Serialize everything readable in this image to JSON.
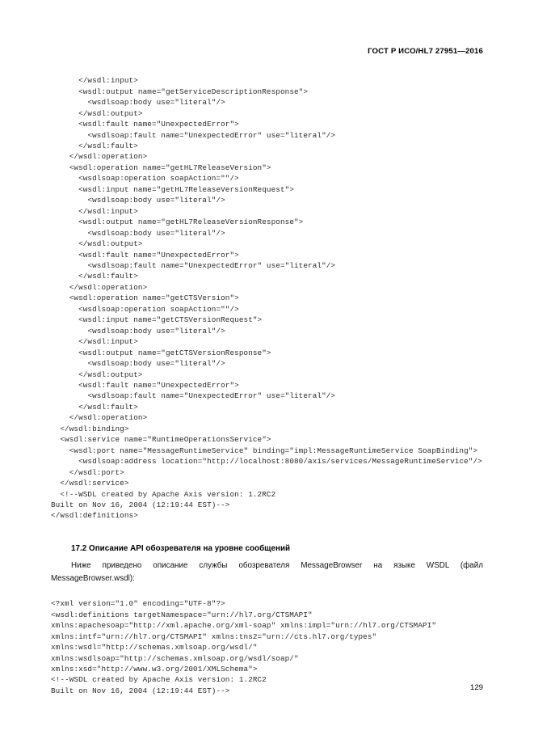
{
  "document": {
    "running_header": "ГОСТ Р ИСО/HL7 27951—2016",
    "page_number": "129"
  },
  "code_block_1": {
    "name": "wsdl-binding-service-listing",
    "lines": [
      "      </wsdl:input>",
      "      <wsdl:output name=\"getServiceDescriptionResponse\">",
      "        <wsdlsoap:body use=\"literal\"/>",
      "      </wsdl:output>",
      "      <wsdl:fault name=\"UnexpectedError\">",
      "        <wsdlsoap:fault name=\"UnexpectedError\" use=\"literal\"/>",
      "      </wsdl:fault>",
      "    </wsdl:operation>",
      "    <wsdl:operation name=\"getHL7ReleaseVersion\">",
      "      <wsdlsoap:operation soapAction=\"\"/>",
      "      <wsdl:input name=\"getHL7ReleaseVersionRequest\">",
      "        <wsdlsoap:body use=\"literal\"/>",
      "      </wsdl:input>",
      "      <wsdl:output name=\"getHL7ReleaseVersionResponse\">",
      "        <wsdlsoap:body use=\"literal\"/>",
      "      </wsdl:output>",
      "      <wsdl:fault name=\"UnexpectedError\">",
      "        <wsdlsoap:fault name=\"UnexpectedError\" use=\"literal\"/>",
      "      </wsdl:fault>",
      "    </wsdl:operation>",
      "    <wsdl:operation name=\"getCTSVersion\">",
      "      <wsdlsoap:operation soapAction=\"\"/>",
      "      <wsdl:input name=\"getCTSVersionRequest\">",
      "        <wsdlsoap:body use=\"literal\"/>",
      "      </wsdl:input>",
      "      <wsdl:output name=\"getCTSVersionResponse\">",
      "        <wsdlsoap:body use=\"literal\"/>",
      "      </wsdl:output>",
      "      <wsdl:fault name=\"UnexpectedError\">",
      "        <wsdlsoap:fault name=\"UnexpectedError\" use=\"literal\"/>",
      "      </wsdl:fault>",
      "    </wsdl:operation>",
      "  </wsdl:binding>",
      "  <wsdl:service name=\"RuntimeOperationsService\">",
      "    <wsdl:port name=\"MessageRuntimeService\" binding=\"impl:MessageRuntimeService SoapBinding\">",
      "      <wsdlsoap:address location=\"http://localhost:8080/axis/services/MessageRuntimeService\"/>",
      "    </wsdl:port>",
      "  </wsdl:service>",
      "  <!--WSDL created by Apache Axis version: 1.2RC2",
      "Built on Nov 16, 2004 (12:19:44 EST)-->",
      "</wsdl:definitions>"
    ]
  },
  "section": {
    "heading": "17.2 Описание API обозревателя на уровне сообщений",
    "paragraph": "Ниже приведено описание службы обозревателя MessageBrowser на языке WSDL (файл MessageBrowser.wsdl):"
  },
  "code_block_2": {
    "name": "messagebrowser-wsdl-header-listing",
    "lines": [
      "<?xml version=\"1.0\" encoding=\"UTF-8\"?>",
      "<wsdl:definitions targetNamespace=\"urn://hl7.org/CTSMAPI\"",
      "xmlns:apachesoap=\"http://xml.apache.org/xml-soap\" xmlns:impl=\"urn://hl7.org/CTSMAPI\" xmlns:intf=\"urn://hl7.org/CTSMAPI\" xmlns:tns2=\"urn://cts.hl7.org/types\"",
      "xmlns:wsdl=\"http://schemas.xmlsoap.org/wsdl/\" xmlns:wsdlsoap=\"http://schemas.xmlsoap.org/wsdl/soap/\" xmlns:xsd=\"http://www.w3.org/2001/XMLSchema\">",
      "<!--WSDL created by Apache Axis version: 1.2RC2",
      "Built on Nov 16, 2004 (12:19:44 EST)-->"
    ]
  }
}
